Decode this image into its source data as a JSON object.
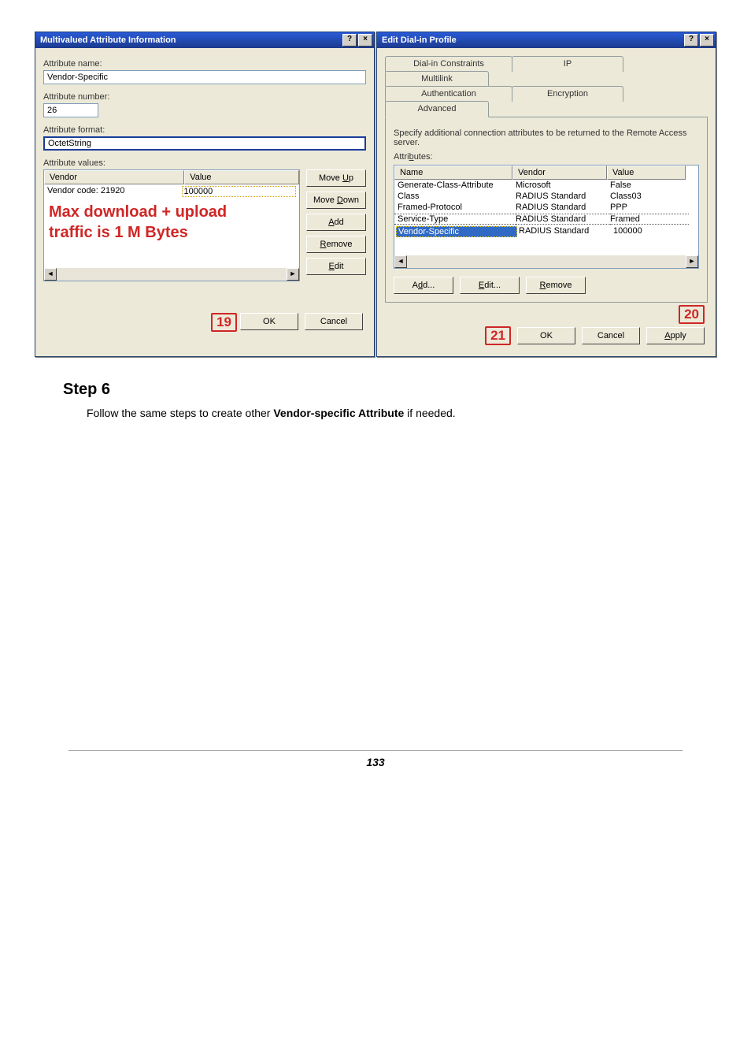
{
  "left_dialog": {
    "title": "Multivalued Attribute Information",
    "labels": {
      "attr_name": "Attribute name:",
      "attr_number": "Attribute number:",
      "attr_format": "Attribute format:",
      "attr_values": "Attribute values:"
    },
    "fields": {
      "attr_name_value": "Vendor-Specific",
      "attr_number_value": "26",
      "attr_format_value": "OctetString"
    },
    "list": {
      "headers": {
        "col1": "Vendor",
        "col2": "Value"
      },
      "row": {
        "vendor": "Vendor code: 21920",
        "value": "100000"
      }
    },
    "side_buttons": {
      "move_up": "Move Up",
      "move_down": "Move Down",
      "add": "Add",
      "remove": "Remove",
      "edit": "Edit"
    },
    "bottom": {
      "ok": "OK",
      "cancel": "Cancel"
    },
    "annot": {
      "ok_num": "19"
    },
    "overlay_text1": "Max download + upload",
    "overlay_text2": "traffic is 1 M Bytes"
  },
  "right_dialog": {
    "title": "Edit Dial-in Profile",
    "tabs": {
      "row1": {
        "t1": "Dial-in Constraints",
        "t2": "IP",
        "t3": "Multilink"
      },
      "row2": {
        "t1": "Authentication",
        "t2": "Encryption",
        "t3": "Advanced"
      }
    },
    "desc": "Specify additional connection attributes to be returned to the Remote Access server.",
    "attributes_label": "Attributes:",
    "headers": {
      "name": "Name",
      "vendor": "Vendor",
      "value": "Value"
    },
    "rows": [
      {
        "name": "Generate-Class-Attribute",
        "vendor": "Microsoft",
        "value": "False"
      },
      {
        "name": "Class",
        "vendor": "RADIUS Standard",
        "value": "Class03"
      },
      {
        "name": "Framed-Protocol",
        "vendor": "RADIUS Standard",
        "value": "PPP"
      },
      {
        "name": "Service-Type",
        "vendor": "RADIUS Standard",
        "value": "Framed",
        "dotted": true
      },
      {
        "name": "Vendor-Specific",
        "vendor": "RADIUS Standard",
        "value": "100000",
        "selected": true
      }
    ],
    "buttons": {
      "add": "Add...",
      "edit": "Edit...",
      "remove": "Remove"
    },
    "bottom": {
      "ok": "OK",
      "cancel": "Cancel",
      "apply": "Apply"
    },
    "annot": {
      "ok_num": "21",
      "apply_num": "20"
    }
  },
  "step": {
    "heading": "Step 6",
    "text_pre": "Follow the same steps to create other ",
    "text_bold": "Vendor-specific Attribute",
    "text_post": " if needed."
  },
  "footer": {
    "page": "133"
  },
  "titlebtns": {
    "help": "?",
    "close": "×"
  }
}
